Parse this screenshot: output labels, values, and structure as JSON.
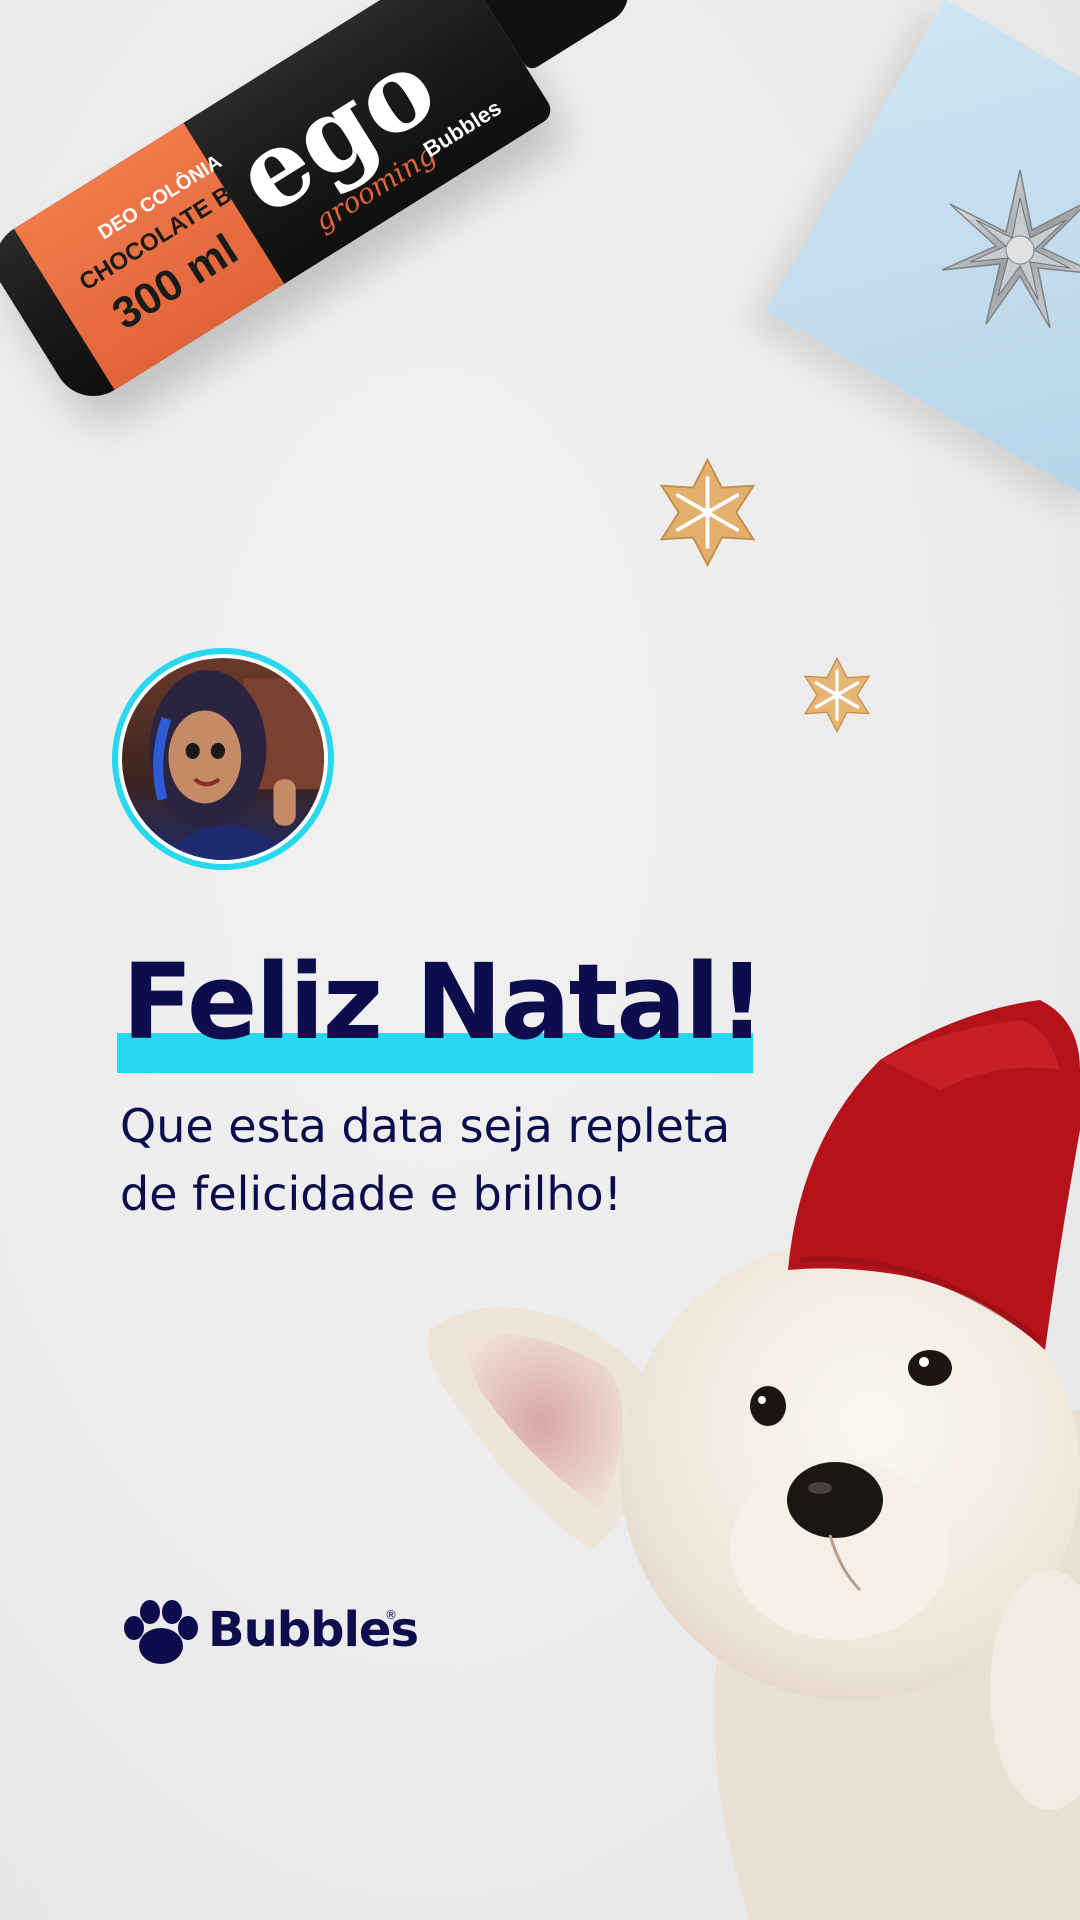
{
  "post": {
    "title": "Feliz Natal!",
    "subtitle_line1": "Que esta data seja repleta",
    "subtitle_line2": "de felicidade e brilho!"
  },
  "product": {
    "logo": "ego",
    "logo_sub": "grooming",
    "line1": "DEO COLÔNIA",
    "line2": "CHOCOLATE BELGA",
    "volume": "300 ml",
    "brand": "Bubbles"
  },
  "brand": {
    "name": "Bubbles",
    "registered": "®"
  },
  "colors": {
    "navy": "#0d0d4d",
    "cyan_accent": "#27d8ee",
    "orange_label": "#e0643a",
    "santa_red": "#b5121b",
    "background": "#ececec"
  },
  "icons": [
    "paw-icon",
    "bow-icon",
    "snowflake-cookie-icon",
    "avatar-portrait"
  ]
}
